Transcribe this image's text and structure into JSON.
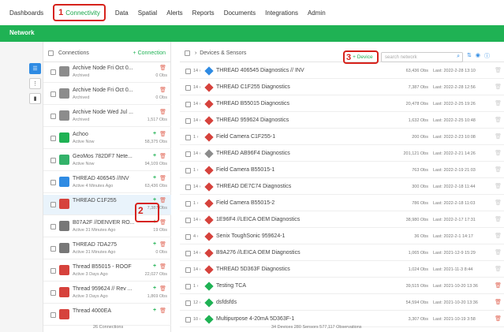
{
  "nav": {
    "items": [
      "Dashboards",
      "Connectivity",
      "Data",
      "Spatial",
      "Alerts",
      "Reports",
      "Documents",
      "Integrations",
      "Admin"
    ],
    "active": "Connectivity",
    "callout": "1"
  },
  "subnav": {
    "tab": "Network"
  },
  "connections": {
    "header": "Connections",
    "add_label": "Connection",
    "footer": "26 Connections",
    "callout": "2",
    "rows": [
      {
        "name": "Archive Node Fri Oct 0...",
        "sub": "Archived",
        "obs": "0 Obs",
        "icon": "archive",
        "color": "#8c8c8c"
      },
      {
        "name": "Archive Node Fri Oct 0...",
        "sub": "Archived",
        "obs": "0 Obs",
        "icon": "archive",
        "color": "#8c8c8c"
      },
      {
        "name": "Archive Node Wed Jul ...",
        "sub": "Archived",
        "obs": "1,517 Obs",
        "icon": "archive",
        "color": "#8c8c8c"
      },
      {
        "name": "Achoo",
        "sub": "Active Now",
        "obs": "58,375 Obs",
        "icon": "wifi",
        "color": "#1fb254"
      },
      {
        "name": "GeoMos 782DF7 Nete...",
        "sub": "Active Now",
        "obs": "94,109 Obs",
        "icon": "db",
        "color": "#33b26a"
      },
      {
        "name": "THREAD 406545 //INV",
        "sub": "Active 4 Minutes Ago",
        "obs": "63,436 Obs",
        "icon": "thread",
        "color": "#2f8be3"
      },
      {
        "name": "THREAD C1F255",
        "sub": "",
        "obs": "7,387 Obs",
        "icon": "thread",
        "color": "#d6423c"
      },
      {
        "name": "B07A2F //DENVER RO...",
        "sub": "Active 31 Minutes Ago",
        "obs": "19 Obs",
        "icon": "thread",
        "color": "#777"
      },
      {
        "name": "THREAD 7DA275",
        "sub": "Active 31 Minutes Ago",
        "obs": "0 Obs",
        "icon": "thread",
        "color": "#777"
      },
      {
        "name": "Thread B55015 - ROOF",
        "sub": "Active 3 Days Ago",
        "obs": "22,027 Obs",
        "icon": "thread",
        "color": "#d6423c"
      },
      {
        "name": "Thread 959624 // Rev ...",
        "sub": "Active 3 Days Ago",
        "obs": "1,869 Obs",
        "icon": "thread",
        "color": "#d6423c"
      },
      {
        "name": "Thread 4000EA",
        "sub": "",
        "obs": "",
        "icon": "thread",
        "color": "#d6423c"
      }
    ]
  },
  "devices": {
    "header": "Devices & Sensors",
    "add_label": "Device",
    "callout": "3",
    "search_placeholder": "search network",
    "footer": "34 Devices  280 Sensors  577,117 Observations",
    "rows": [
      {
        "count": "14",
        "name": "THREAD 406545 Diagnostics // INV",
        "obs": "63,436 Obs",
        "last": "Last: 2022-2-28 13:10",
        "color": "#2f8be3",
        "trash_red": false
      },
      {
        "count": "14",
        "name": "THREAD C1F255 Diagnostics",
        "obs": "7,387 Obs",
        "last": "Last: 2022-2-28 12:56",
        "color": "#d6423c",
        "trash_red": false
      },
      {
        "count": "14",
        "name": "THREAD B55015 Diagnostics",
        "obs": "20,478 Obs",
        "last": "Last: 2022-2-25 19:26",
        "color": "#d6423c",
        "trash_red": false
      },
      {
        "count": "14",
        "name": "THREAD 959624 Diagnostics",
        "obs": "1,632 Obs",
        "last": "Last: 2022-2-25 10:48",
        "color": "#d6423c",
        "trash_red": false
      },
      {
        "count": "1",
        "name": "Field Camera C1F255-1",
        "obs": "200 Obs",
        "last": "Last: 2022-2-23 10:08",
        "color": "#d6423c",
        "trash_red": false
      },
      {
        "count": "14",
        "name": "THREAD AB96F4 Diagnostics",
        "obs": "201,121 Obs",
        "last": "Last: 2022-2-21 14:26",
        "color": "#8c8c8c",
        "trash_red": false
      },
      {
        "count": "1",
        "name": "Field Camera B55015-1",
        "obs": "763 Obs",
        "last": "Last: 2022-2-19 21:03",
        "color": "#d6423c",
        "trash_red": false
      },
      {
        "count": "14",
        "name": "THREAD DE7C74 Diagnostics",
        "obs": "300 Obs",
        "last": "Last: 2022-2-18 11:44",
        "color": "#d6423c",
        "trash_red": false
      },
      {
        "count": "1",
        "name": "Field Camera B55015-2",
        "obs": "786 Obs",
        "last": "Last: 2022-2-18 11:03",
        "color": "#d6423c",
        "trash_red": false
      },
      {
        "count": "14",
        "name": "1E96F4 //LEICA OEM Diagnostics",
        "obs": "38,980 Obs",
        "last": "Last: 2022-2-17 17:31",
        "color": "#d6423c",
        "trash_red": false
      },
      {
        "count": "4",
        "name": "Senix ToughSonic 959624-1",
        "obs": "36 Obs",
        "last": "Last: 2022-2-1 14:17",
        "color": "#d6423c",
        "trash_red": false
      },
      {
        "count": "14",
        "name": "B9A276 //LEICA OEM Diagnostics",
        "obs": "1,065 Obs",
        "last": "Last: 2021-12-9 15:29",
        "color": "#d6423c",
        "trash_red": false
      },
      {
        "count": "14",
        "name": "THREAD 5D363F Diagnostics",
        "obs": "1,024 Obs",
        "last": "Last: 2021-11-3 8:44",
        "color": "#d6423c",
        "trash_red": false
      },
      {
        "count": "1",
        "name": "Testing TCA",
        "obs": "39,515 Obs",
        "last": "Last: 2021-10-20 13:36",
        "color": "#1fb254",
        "trash_red": true
      },
      {
        "count": "12",
        "name": "dsfdsfds",
        "obs": "54,594 Obs",
        "last": "Last: 2021-10-20 13:36",
        "color": "#1fb254",
        "trash_red": true
      },
      {
        "count": "10",
        "name": "Multipurpose 4-20mA 5D363F-1",
        "obs": "3,307 Obs",
        "last": "Last: 2021-10-19 3:58",
        "color": "#1fb254",
        "trash_red": true
      }
    ]
  }
}
